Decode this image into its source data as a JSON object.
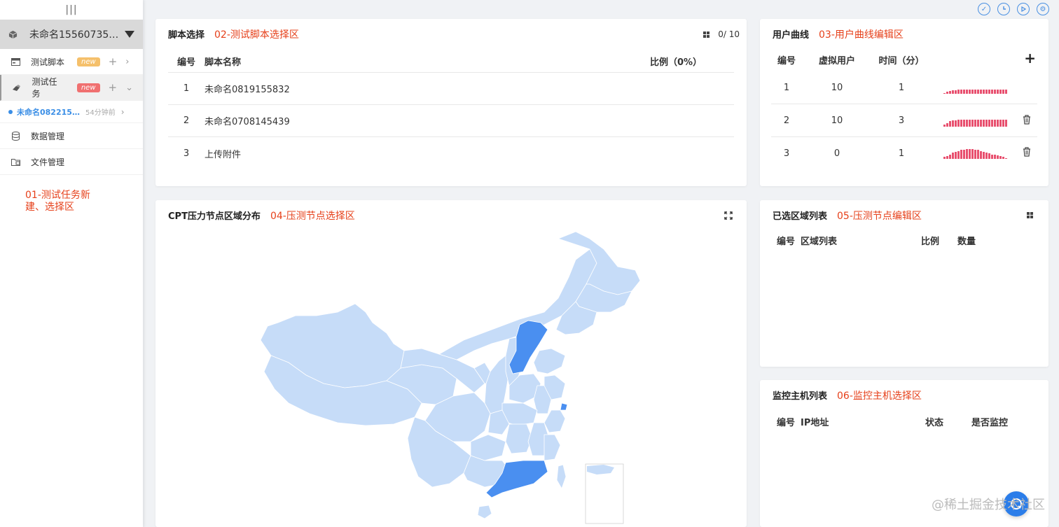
{
  "sidebar": {
    "handle": "|||",
    "project_name": "未命名1556073568...",
    "items": [
      {
        "label": "测试脚本",
        "badge": "new",
        "badge_color": "#f5a623"
      },
      {
        "label": "测试任务",
        "badge": "new",
        "badge_color": "#f06363"
      },
      {
        "label": "数据管理"
      },
      {
        "label": "文件管理"
      }
    ],
    "sub_task": {
      "label": "未命名0822151...",
      "time": "54分钟前"
    },
    "annotation": "01-测试任务新建、选择区"
  },
  "script_panel": {
    "title": "脚本选择",
    "annotation": "02-测试脚本选择区",
    "counter": "0/ 10",
    "columns": [
      "编号",
      "脚本名称",
      "比例（0%）"
    ],
    "rows": [
      {
        "no": "1",
        "name": "未命名0819155832"
      },
      {
        "no": "2",
        "name": "未命名0708145439"
      },
      {
        "no": "3",
        "name": "上传附件"
      }
    ]
  },
  "curve_panel": {
    "title": "用户曲线",
    "annotation": "03-用户曲线编辑区",
    "columns": [
      "编号",
      "虚拟用户",
      "时间（分）"
    ],
    "add_icon": "+",
    "rows": [
      {
        "no": "1",
        "users": "10",
        "time": "1",
        "spark": [
          1,
          2,
          3,
          4,
          4,
          5,
          5,
          5,
          5,
          5,
          5,
          5,
          5,
          5,
          5,
          5,
          5,
          5,
          5,
          5,
          5,
          5,
          5
        ],
        "deletable": false
      },
      {
        "no": "2",
        "users": "10",
        "time": "3",
        "spark": [
          2,
          4,
          6,
          7,
          7,
          8,
          8,
          8,
          8,
          8,
          8,
          8,
          8,
          8,
          8,
          8,
          8,
          8,
          8,
          8,
          8,
          8,
          8
        ],
        "deletable": true
      },
      {
        "no": "3",
        "users": "0",
        "time": "1",
        "spark": [
          2,
          3,
          5,
          7,
          8,
          9,
          10,
          10,
          11,
          11,
          11,
          10,
          10,
          9,
          8,
          7,
          6,
          5,
          5,
          4,
          3,
          2,
          1
        ],
        "deletable": true
      }
    ]
  },
  "map_panel": {
    "title": "CPT压力节点区域分布",
    "annotation": "04-压测节点选择区",
    "colors": {
      "base": "#c6dcf8",
      "selected": "#4a8ff0",
      "border": "#ffffff"
    }
  },
  "region_panel": {
    "title": "已选区域列表",
    "annotation": "05-压测节点编辑区",
    "columns": [
      "编号",
      "区域列表",
      "比例",
      "数量"
    ]
  },
  "host_panel": {
    "title": "监控主机列表",
    "annotation": "06-监控主机选择区",
    "columns": [
      "编号",
      "IP地址",
      "状态",
      "是否监控"
    ]
  },
  "watermark": "@稀土掘金技术社区"
}
